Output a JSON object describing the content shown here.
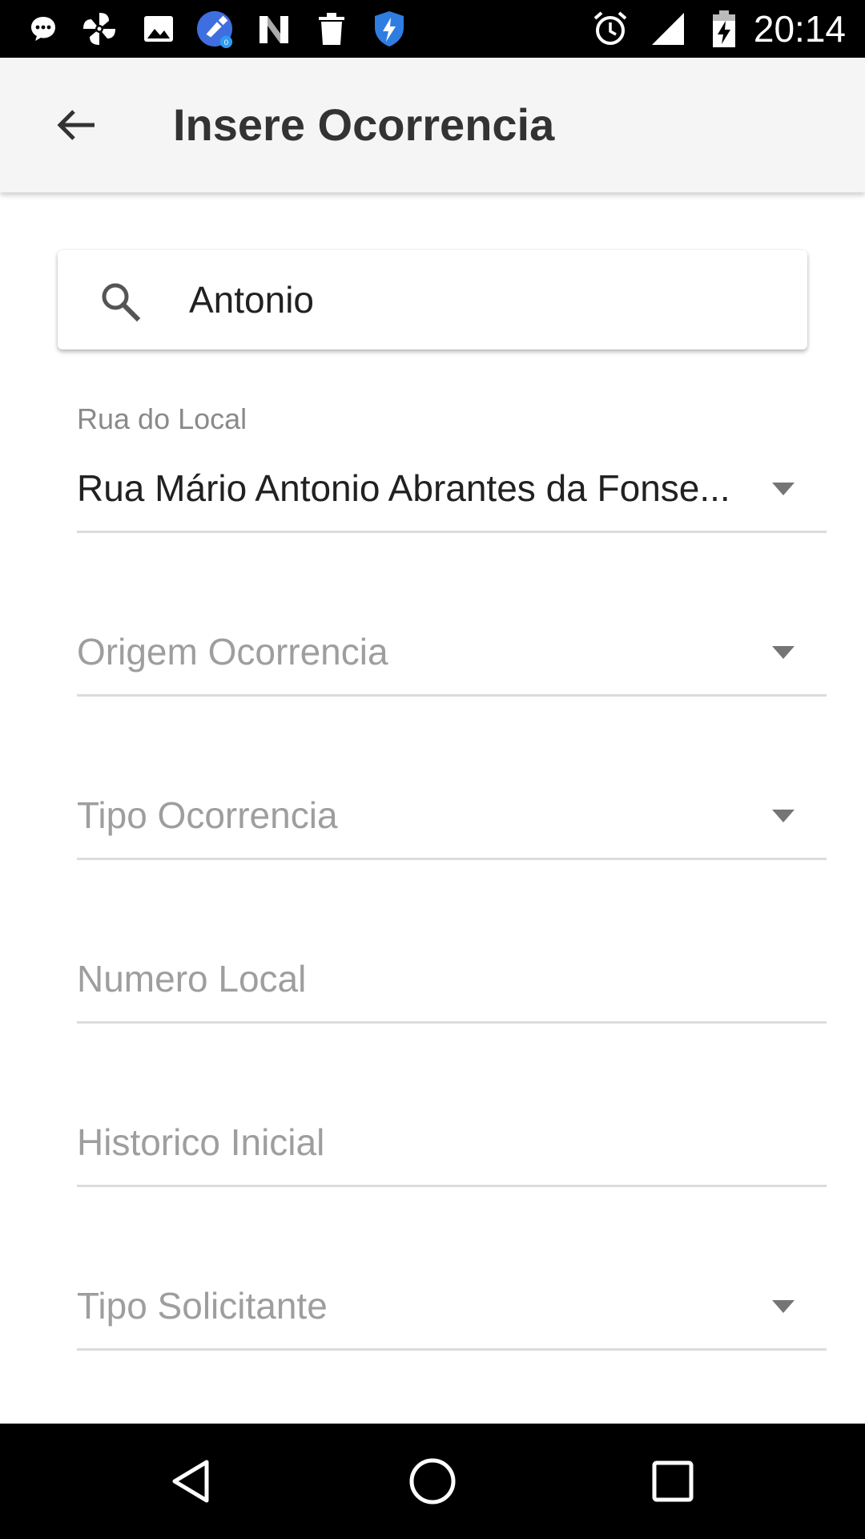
{
  "status_bar": {
    "time": "20:14",
    "notification_icons": [
      "chat-bubble-icon",
      "pinwheel-icon",
      "image-icon",
      "cleaner-app-icon",
      "n-app-icon",
      "trash-icon",
      "shield-bolt-icon"
    ],
    "system_icons": [
      "alarm-icon",
      "cell-signal-icon",
      "battery-charging-icon"
    ]
  },
  "app_bar": {
    "title": "Insere Ocorrencia",
    "back_icon": "arrow-back-icon"
  },
  "search": {
    "value": "Antonio",
    "icon": "search-icon"
  },
  "form": {
    "rua_label": "Rua do Local",
    "rua_value": "Rua Mário Antonio Abrantes da Fonse...",
    "origem_placeholder": "Origem Ocorrencia",
    "tipo_placeholder": "Tipo Ocorrencia",
    "numero_placeholder": "Numero Local",
    "historico_placeholder": "Historico Inicial",
    "solicitante_placeholder": "Tipo Solicitante"
  },
  "nav_bar": {
    "back": "nav-back-icon",
    "home": "nav-home-icon",
    "recents": "nav-recents-icon"
  },
  "colors": {
    "app_bar_bg": "#f5f5f5",
    "title_text": "#333333",
    "hint_text": "#9e9e9e",
    "divider": "#dcdcdc",
    "system_bar": "#000000"
  }
}
